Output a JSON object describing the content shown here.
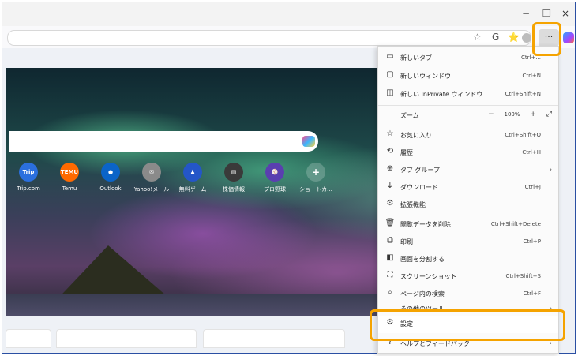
{
  "window": {
    "minimize": "−",
    "restore": "❐",
    "close": "×"
  },
  "toolbar": {
    "more_label": "···",
    "favorites_icon": "☆",
    "refresh_icon": "G",
    "collections_icon": "⭐"
  },
  "ntp": {
    "tiles": [
      {
        "label": "Trip.com",
        "short": "Trip",
        "color": "#2b6fde"
      },
      {
        "label": "Temu",
        "short": "TEMU",
        "color": "#ff6a00"
      },
      {
        "label": "Outlook",
        "short": "●",
        "color": "#0b64c8"
      },
      {
        "label": "Yahoo!メール",
        "short": "✉",
        "color": "#8a8a8a"
      },
      {
        "label": "無料ゲーム",
        "short": "♟",
        "color": "#2456c8"
      },
      {
        "label": "株価情報",
        "short": "▤",
        "color": "#3a3a3a"
      },
      {
        "label": "プロ野球",
        "short": "⚾",
        "color": "#5a3fb0"
      },
      {
        "label": "ショートカ...",
        "short": "+",
        "color": "rgba(255,255,255,0.2)"
      }
    ]
  },
  "menu": {
    "items": [
      {
        "icon": "▭",
        "label": "新しいタブ",
        "shortcut": "Ctrl+..."
      },
      {
        "icon": "▢",
        "label": "新しいウィンドウ",
        "shortcut": "Ctrl+N"
      },
      {
        "icon": "◫",
        "label": "新しい InPrivate ウィンドウ",
        "shortcut": "Ctrl+Shift+N"
      },
      {
        "icon": "",
        "label": "ズーム",
        "shortcut": ""
      },
      {
        "icon": "☆",
        "label": "お気に入り",
        "shortcut": "Ctrl+Shift+O"
      },
      {
        "icon": "⟲",
        "label": "履歴",
        "shortcut": "Ctrl+H"
      },
      {
        "icon": "⊕",
        "label": "タブ グループ",
        "shortcut": ""
      },
      {
        "icon": "↓",
        "label": "ダウンロード",
        "shortcut": "Ctrl+J"
      },
      {
        "icon": "⚙",
        "label": "拡張機能",
        "shortcut": ""
      },
      {
        "icon": "🗑",
        "label": "閲覧データを削除",
        "shortcut": "Ctrl+Shift+Delete"
      },
      {
        "icon": "⎙",
        "label": "印刷",
        "shortcut": "Ctrl+P"
      },
      {
        "icon": "◧",
        "label": "画面を分割する",
        "shortcut": ""
      },
      {
        "icon": "⛶",
        "label": "スクリーンショット",
        "shortcut": "Ctrl+Shift+S"
      },
      {
        "icon": "⌕",
        "label": "ページ内の検索",
        "shortcut": "Ctrl+F"
      },
      {
        "icon": "",
        "label": "その他のツール",
        "shortcut": ""
      },
      {
        "icon": "⚙",
        "label": "設定",
        "shortcut": ""
      },
      {
        "icon": "?",
        "label": "ヘルプとフィードバック",
        "shortcut": ""
      }
    ],
    "zoom": {
      "minus": "−",
      "value": "100%",
      "plus": "+",
      "fullscreen": "⤢"
    },
    "arrow": "›"
  }
}
